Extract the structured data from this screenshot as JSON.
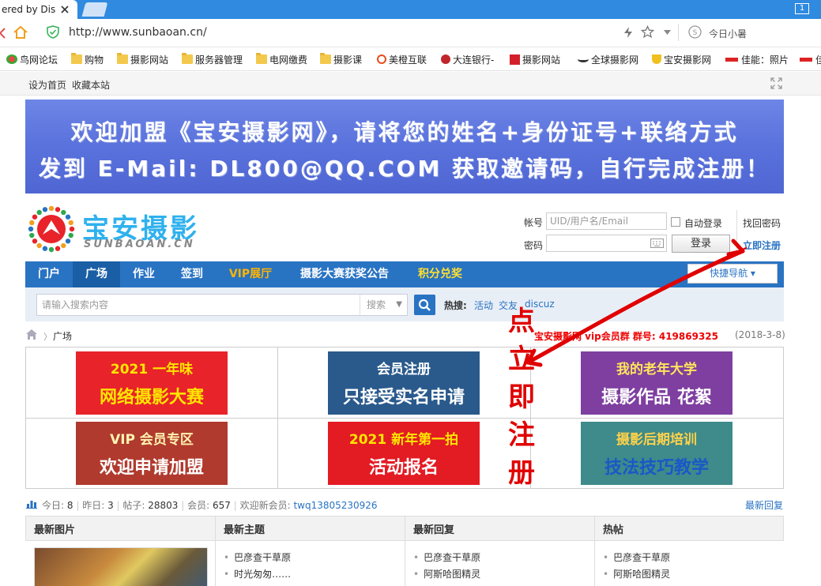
{
  "browser": {
    "tab_title": "ered by Dis",
    "tab_counter": "1",
    "url": "http://www.sunbaoan.cn/",
    "weather": "今日小暑",
    "bookmarks": [
      "鸟网论坛",
      "购物",
      "摄影网站",
      "服务器管理",
      "电网缴费",
      "摄影课",
      "美橙互联",
      "大连银行-",
      "摄影网站",
      "全球摄影网",
      "宝安摄影网",
      "佳能：照片",
      "佳"
    ]
  },
  "site_topbar": {
    "set_home": "设为首页",
    "add_favorite": "收藏本站"
  },
  "banner": {
    "line1": "欢迎加盟《宝安摄影网》，请将您的姓名+身份证号+联络方式",
    "line2": "发到 E-Mail: DL800@QQ.COM 获取邀请码，自行完成注册！"
  },
  "logo": {
    "cn": "宝安摄影",
    "en": "SUNBAOAN.CN"
  },
  "login": {
    "account_label": "帐号",
    "account_placeholder": "UID/用户名/Email",
    "auto_login": "自动登录",
    "find_password": "找回密码",
    "password_label": "密码",
    "login_button": "登录",
    "register_now": "立即注册"
  },
  "nav": {
    "items": [
      "门户",
      "广场",
      "作业",
      "签到",
      "VIP展厅",
      "摄影大赛获奖公告",
      "积分兑奖"
    ],
    "quick_nav": "快捷导航"
  },
  "search": {
    "placeholder": "请输入搜索内容",
    "type": "搜索",
    "hot_label": "热搜:",
    "hot_links": [
      "活动",
      "交友",
      "discuz"
    ]
  },
  "breadcrumb": {
    "current": "广场",
    "group_info": "宝安摄影网 vip会员群 群号: 419869325",
    "date": "(2018-3-8)"
  },
  "tiles": [
    {
      "line1": "2021 一年味",
      "line2": "网络摄影大赛",
      "bg": "#e8232a",
      "c1": "#ffe600",
      "c2": "#ffe600"
    },
    {
      "line1": "会员注册",
      "line2": "只接受实名申请",
      "bg": "#2a5a8c",
      "c1": "#ffffff",
      "c2": "#ffffff"
    },
    {
      "line1": "我的老年大学",
      "line2": "摄影作品 花絮",
      "bg": "#7e3fa0",
      "c1": "#ffe65a",
      "c2": "#ffffff"
    },
    {
      "line1": "VIP 会员专区",
      "line2": "欢迎申请加盟",
      "bg": "#b03a2e",
      "c1": "#fff3b0",
      "c2": "#ffffff"
    },
    {
      "line1": "2021 新年第一拍",
      "line2": "活动报名",
      "bg": "#e31b23",
      "c1": "#ffe600",
      "c2": "#ffffff"
    },
    {
      "line1": "摄影后期培训",
      "line2": "技法技巧教学",
      "bg": "#3f8a8a",
      "c1": "#ffd24a",
      "c2": "#1a58c8"
    }
  ],
  "stats": {
    "today_label": "今日:",
    "today": "8",
    "yesterday_label": "昨日:",
    "yesterday": "3",
    "posts_label": "帖子:",
    "posts": "28803",
    "members_label": "会员:",
    "members": "657",
    "welcome_label": "欢迎新会员:",
    "new_member": "twq13805230926",
    "latest_reply_link": "最新回复"
  },
  "columns": {
    "headers": [
      "最新图片",
      "最新主题",
      "最新回复",
      "热帖"
    ],
    "latest_topics": [
      "巴彦查干草原",
      "时光匆匆……"
    ],
    "latest_replies": [
      "巴彦查干草原",
      "阿斯哈图精灵"
    ],
    "hot_posts": [
      "巴彦查干草原",
      "阿斯哈图精灵"
    ]
  },
  "annotation": {
    "text": "点立即注册",
    "color": "#e00000"
  }
}
